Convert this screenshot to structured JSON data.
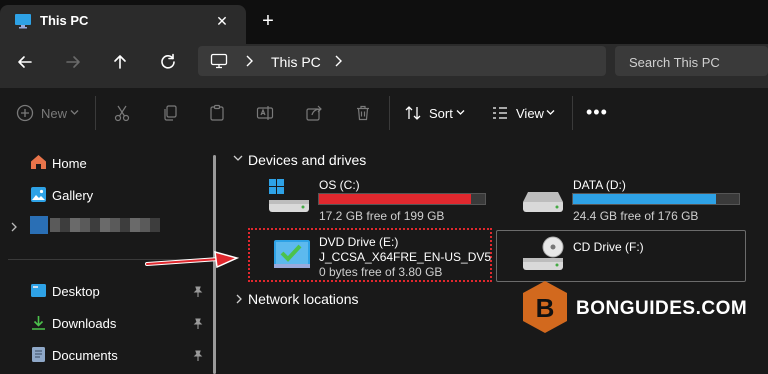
{
  "tab": {
    "title": "This PC",
    "close_glyph": "✕",
    "new_tab_glyph": "+"
  },
  "address": {
    "location": "This PC",
    "search_placeholder": "Search This PC"
  },
  "toolbar": {
    "new_label": "New",
    "sort_label": "Sort",
    "view_label": "View",
    "more_glyph": "•••"
  },
  "sidebar": {
    "items": [
      {
        "label": "Home",
        "icon": "home-icon"
      },
      {
        "label": "Gallery",
        "icon": "gallery-icon"
      },
      {
        "label": "",
        "icon": "cloud-account-icon"
      },
      {
        "label": "Desktop",
        "icon": "desktop-folder-icon",
        "pinned": true
      },
      {
        "label": "Downloads",
        "icon": "download-icon",
        "pinned": true
      },
      {
        "label": "Documents",
        "icon": "documents-icon",
        "pinned": true
      }
    ]
  },
  "main": {
    "devices_title": "Devices and drives",
    "network_title": "Network locations",
    "drives": [
      {
        "name": "OS (C:)",
        "free": "17.2 GB free of 199 GB",
        "used_fraction": 0.914,
        "bar_color": "#e0282e"
      },
      {
        "name": "DATA (D:)",
        "free": "24.4 GB free of 176 GB",
        "used_fraction": 0.861,
        "bar_color": "#2ea2e6"
      },
      {
        "name": "DVD Drive (E:)",
        "label": "J_CCSA_X64FRE_EN-US_DV5",
        "free": "0 bytes free of 3.80 GB"
      },
      {
        "name": "CD Drive (F:)"
      }
    ]
  },
  "watermark": {
    "text": "BONGUIDES.COM",
    "logo_letter": "B",
    "accent": "#e0282e"
  },
  "colors": {
    "accent_blue": "#2ea2e6",
    "warning_red": "#e0282e",
    "brand_orange": "#d2691e"
  }
}
